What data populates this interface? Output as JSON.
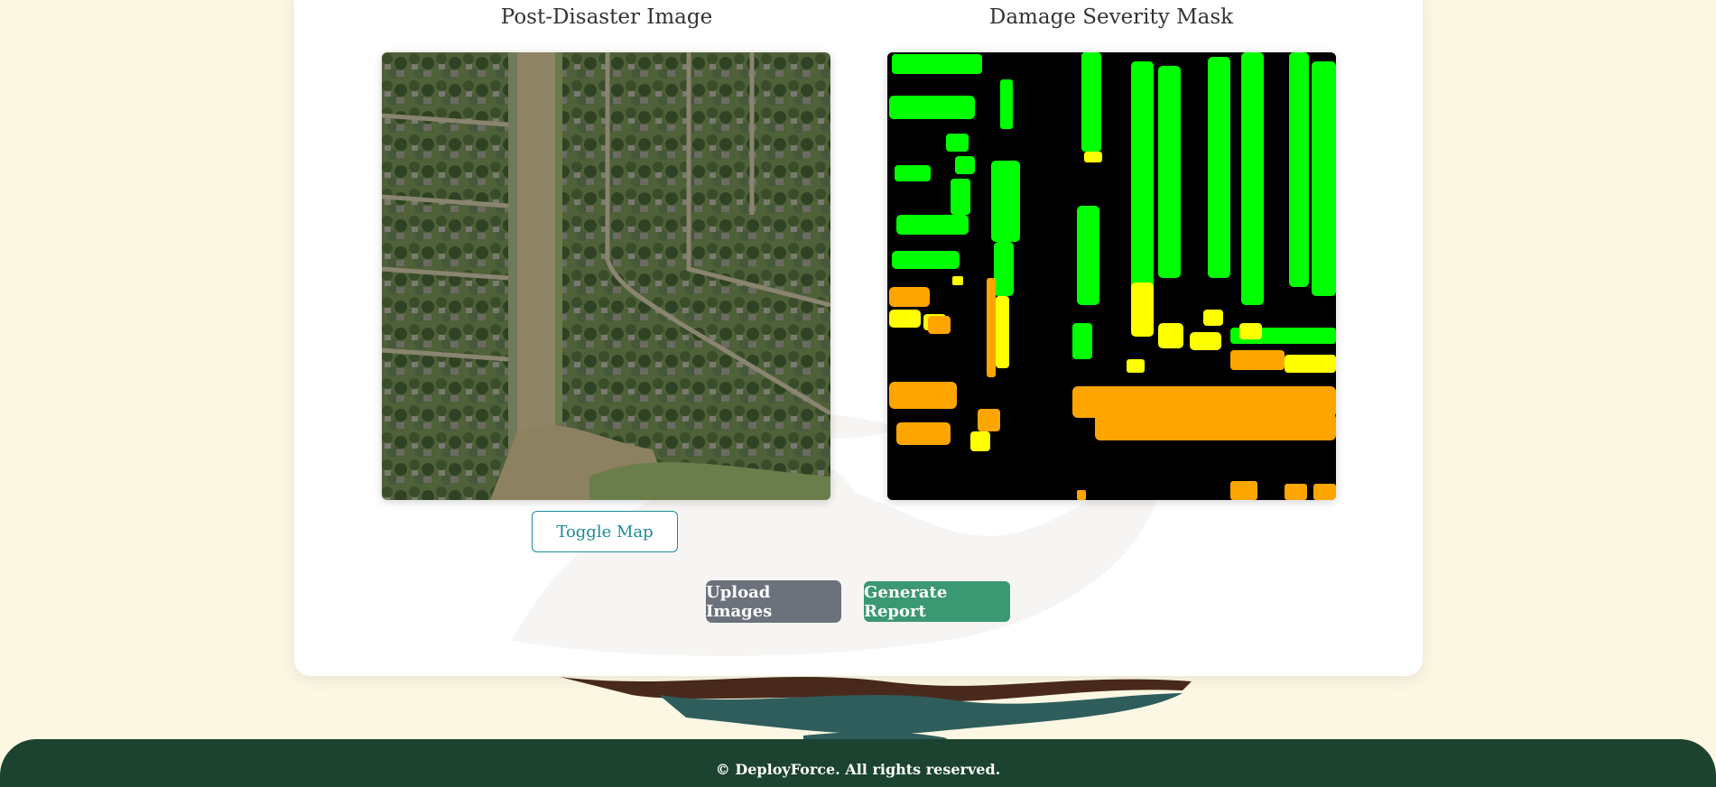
{
  "panels": {
    "post_title": "Post-Disaster Image",
    "mask_title": "Damage Severity Mask"
  },
  "buttons": {
    "toggle_map": "Toggle Map",
    "upload": "Upload Images",
    "generate": "Generate Report"
  },
  "footer": {
    "text": "© DeployForce. All rights reserved."
  },
  "colors": {
    "no_damage": "#00ff00",
    "minor_damage": "#ffff00",
    "major_damage": "#ffa500",
    "background_mask": "#000000",
    "accent": "#1b8c9c",
    "footer_bg": "#1c4330"
  }
}
